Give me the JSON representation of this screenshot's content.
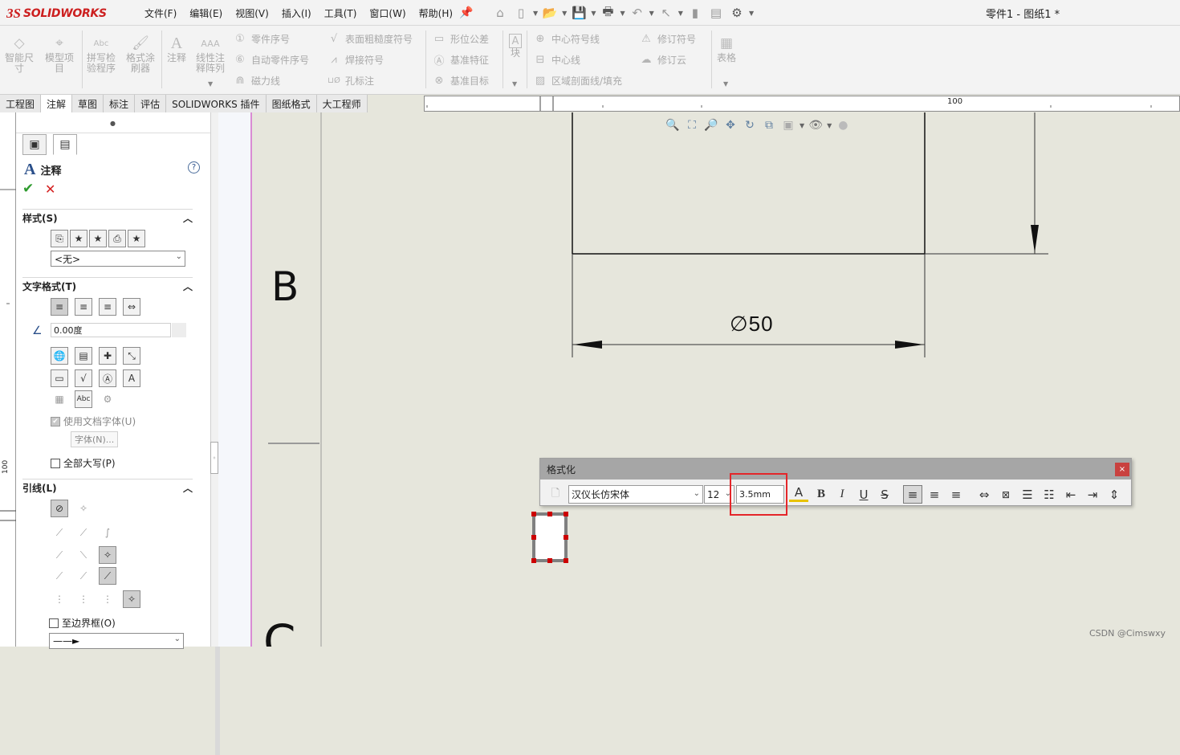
{
  "app": {
    "logo_mark": "3S",
    "logo_text": "SOLIDWORKS",
    "title": "零件1 - 图纸1 *"
  },
  "menu": [
    "文件(F)",
    "编辑(E)",
    "视图(V)",
    "插入(I)",
    "工具(T)",
    "窗口(W)",
    "帮助(H)"
  ],
  "ribbon": {
    "big": [
      {
        "label": "智能尺\n寸",
        "icon": "smart-dimension-icon"
      },
      {
        "label": "模型项\n目",
        "icon": "model-items-icon"
      },
      {
        "label": "拼写检\n验程序",
        "icon": "spell-check-icon"
      },
      {
        "label": "格式涂\n刷器",
        "icon": "format-painter-icon"
      },
      {
        "label": "注释",
        "icon": "note-icon"
      },
      {
        "label": "线性注\n释阵列",
        "icon": "linear-note-pattern-icon"
      },
      {
        "label": "块",
        "icon": "block-icon"
      },
      {
        "label": "表格",
        "icon": "table-icon"
      }
    ],
    "small": [
      {
        "label": "零件序号",
        "icon": "balloon-icon"
      },
      {
        "label": "自动零件序号",
        "icon": "auto-balloon-icon"
      },
      {
        "label": "磁力线",
        "icon": "magnetic-line-icon"
      },
      {
        "label": "表面粗糙度符号",
        "icon": "surface-finish-icon"
      },
      {
        "label": "焊接符号",
        "icon": "weld-symbol-icon"
      },
      {
        "label": "孔标注",
        "icon": "hole-callout-icon"
      },
      {
        "label": "形位公差",
        "icon": "geometric-tolerance-icon"
      },
      {
        "label": "基准特征",
        "icon": "datum-feature-icon"
      },
      {
        "label": "基准目标",
        "icon": "datum-target-icon"
      },
      {
        "label": "中心符号线",
        "icon": "center-mark-icon"
      },
      {
        "label": "中心线",
        "icon": "centerline-icon"
      },
      {
        "label": "区域剖面线/填充",
        "icon": "area-hatch-icon"
      },
      {
        "label": "修订符号",
        "icon": "revision-symbol-icon"
      },
      {
        "label": "修订云",
        "icon": "revision-cloud-icon"
      }
    ]
  },
  "tabs": [
    "工程图",
    "注解",
    "草图",
    "标注",
    "评估",
    "SOLIDWORKS 插件",
    "图纸格式",
    "大工程师"
  ],
  "ruler": {
    "h_label": "100",
    "v_label": "100"
  },
  "panel": {
    "title": "注释",
    "help": "?",
    "ok": "✔",
    "cancel": "✕",
    "style_section": "样式(S)",
    "style_value": "<无>",
    "text_format_section": "文字格式(T)",
    "angle_value": "0.00度",
    "use_doc_font": "使用文档字体(U)",
    "font_button": "字体(N)...",
    "all_caps": "全部大写(P)",
    "leader_section": "引线(L)",
    "to_boundary": "至边界框(O)"
  },
  "drawing": {
    "zone_b": "B",
    "zone_c": "C",
    "dimension": "∅50"
  },
  "format_toolbar": {
    "title": "格式化",
    "close": "×",
    "font": "汉仪长仿宋体",
    "size": "12",
    "height": "3.5mm",
    "bold": "B",
    "italic": "I",
    "underline": "U",
    "strike": "S"
  },
  "watermark": "CSDN @Cimswxy",
  "colors": {
    "accent": "#cc1f1f",
    "highlight": "#e4262a",
    "canvas": "#e6e6dc",
    "handle": "#cc0000",
    "sheet_border": "#cc33cc"
  }
}
